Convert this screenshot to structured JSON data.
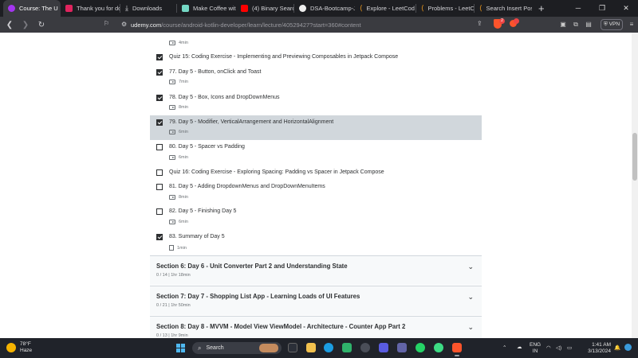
{
  "browser": {
    "tabs": [
      {
        "label": "Course: The U",
        "favicon_color": "#a435f0",
        "active": true
      },
      {
        "label": "Thank you for dow",
        "favicon_color": "#e0245e",
        "active": false
      },
      {
        "label": "Downloads",
        "favicon_color": "#bbbbbb",
        "active": false
      },
      {
        "label": "Make Coffee with",
        "favicon_color": "#74d7c4",
        "active": false
      },
      {
        "label": "(4) Binary Search",
        "favicon_color": "#ff0000",
        "active": false
      },
      {
        "label": "DSA-Bootcamp-Ja",
        "favicon_color": "#eeeeee",
        "active": false
      },
      {
        "label": "Explore - LeetCod",
        "favicon_color": "#f89f1b",
        "active": false
      },
      {
        "label": "Problems - LeetC",
        "favicon_color": "#f89f1b",
        "active": false
      },
      {
        "label": "Search Insert Pos",
        "favicon_color": "#f89f1b",
        "active": false
      }
    ],
    "url_host": "udemy.com",
    "url_path": "/course/android-kotlin-developer/learn/lecture/40529427?start=360#content",
    "vpn_label": "VPN",
    "shield_badge": "2"
  },
  "curriculum": {
    "items": [
      {
        "title": "Quiz 15: Coding Exercise - Implementing and Previewing Composables in Jetpack Compose",
        "checked": true,
        "meta": ""
      },
      {
        "title": "77. Day 5 - Button, onClick and Toast",
        "checked": true,
        "meta": "7min",
        "icon": "video-icon"
      },
      {
        "title": "78. Day 5 - Box, Icons and DropDownMenus",
        "checked": true,
        "meta": "8min",
        "icon": "video-icon"
      },
      {
        "title": "79. Day 5 - Modifier, VerticalArrangement and HorizontalAlignment",
        "checked": true,
        "meta": "6min",
        "icon": "video-icon",
        "active": true
      },
      {
        "title": "80. Day 5 - Spacer vs Padding",
        "checked": false,
        "meta": "6min",
        "icon": "video-icon"
      },
      {
        "title": "Quiz 16: Coding Exercise - Exploring Spacing: Padding vs Spacer in Jetpack Compose",
        "checked": false,
        "meta": ""
      },
      {
        "title": "81. Day 5 - Adding DropdownMenus and DropDownMenuItems",
        "checked": false,
        "meta": "8min",
        "icon": "video-icon"
      },
      {
        "title": "82. Day 5 - Finishing Day 5",
        "checked": false,
        "meta": "6min",
        "icon": "video-icon"
      },
      {
        "title": "83. Summary of Day 5",
        "checked": true,
        "meta": "1min",
        "icon": "document-icon"
      }
    ],
    "top_meta": "4min",
    "sections": [
      {
        "title": "Section 6: Day 6 - Unit Converter Part 2 and Understanding State",
        "meta": "0 / 14 | 1hr 18min"
      },
      {
        "title": "Section 7: Day 7 - Shopping List App - Learning Loads of UI Features",
        "meta": "0 / 21 | 1hr 50min"
      },
      {
        "title": "Section 8: Day 8 - MVVM - Model View ViewModel - Architecture - Counter App Part 2",
        "meta": "0 / 13 | 1hr 9min"
      }
    ]
  },
  "taskbar": {
    "weather_temp": "78°F",
    "weather_desc": "Haze",
    "search_label": "Search",
    "lang_top": "ENG",
    "lang_bottom": "IN",
    "time": "1:41 AM",
    "date": "3/13/2024"
  }
}
